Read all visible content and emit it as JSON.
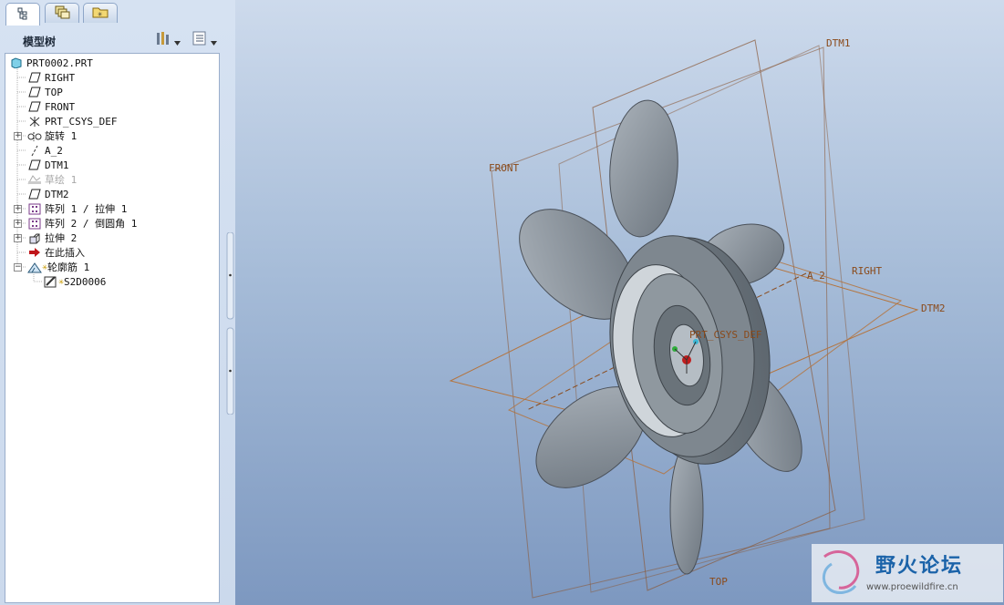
{
  "tabs": [
    {
      "name": "model-tree-tab",
      "icon": "model-tree-icon"
    },
    {
      "name": "layers-tab",
      "icon": "layers-icon"
    },
    {
      "name": "favorites-tab",
      "icon": "folder-star-icon"
    }
  ],
  "panel": {
    "title": "模型树",
    "tools_icon": "hammer-icon",
    "settings_icon": "list-settings-icon"
  },
  "tree": [
    {
      "label": "PRT0002.PRT",
      "icon": "part-icon",
      "expander": false
    },
    {
      "label": "RIGHT",
      "icon": "datum-plane-icon",
      "expander": false
    },
    {
      "label": "TOP",
      "icon": "datum-plane-icon",
      "expander": false
    },
    {
      "label": "FRONT",
      "icon": "datum-plane-icon",
      "expander": false
    },
    {
      "label": "PRT_CSYS_DEF",
      "icon": "csys-icon",
      "expander": false
    },
    {
      "label": "旋转 1",
      "icon": "revolve-icon",
      "expander": true
    },
    {
      "label": "A_2",
      "icon": "datum-axis-icon",
      "expander": false
    },
    {
      "label": "DTM1",
      "icon": "datum-plane-icon",
      "expander": false
    },
    {
      "label": "草绘 1",
      "icon": "sketch-icon",
      "expander": false,
      "dim": true
    },
    {
      "label": "DTM2",
      "icon": "datum-plane-icon",
      "expander": false
    },
    {
      "label": "阵列 1 / 拉伸 1",
      "icon": "pattern-icon",
      "expander": true
    },
    {
      "label": "阵列 2 / 倒圆角 1",
      "icon": "pattern-icon",
      "expander": true
    },
    {
      "label": "拉伸 2",
      "icon": "extrude-icon",
      "expander": true
    },
    {
      "label": "在此插入",
      "icon": "insert-arrow-icon",
      "expander": false
    },
    {
      "label": "轮廓筋 1",
      "icon": "profile-rib-icon",
      "expander": true,
      "star": true
    },
    {
      "label": "S2D0006",
      "icon": "section-sketch-icon",
      "expander": false,
      "star": true,
      "child": true
    }
  ],
  "viewport_labels": {
    "dtm1": "DTM1",
    "front": "FRONT",
    "right": "RIGHT",
    "a2": "A_2",
    "dtm2": "DTM2",
    "csys": "PRT_CSYS_DEF",
    "top": "TOP"
  },
  "watermark": {
    "title": "野火论坛",
    "url": "www.proewildfire.cn"
  },
  "colors": {
    "datum": "#8a4a1a",
    "part": "#8c949c",
    "viewport_top": "#cddaec",
    "viewport_bottom": "#7d98c0"
  }
}
